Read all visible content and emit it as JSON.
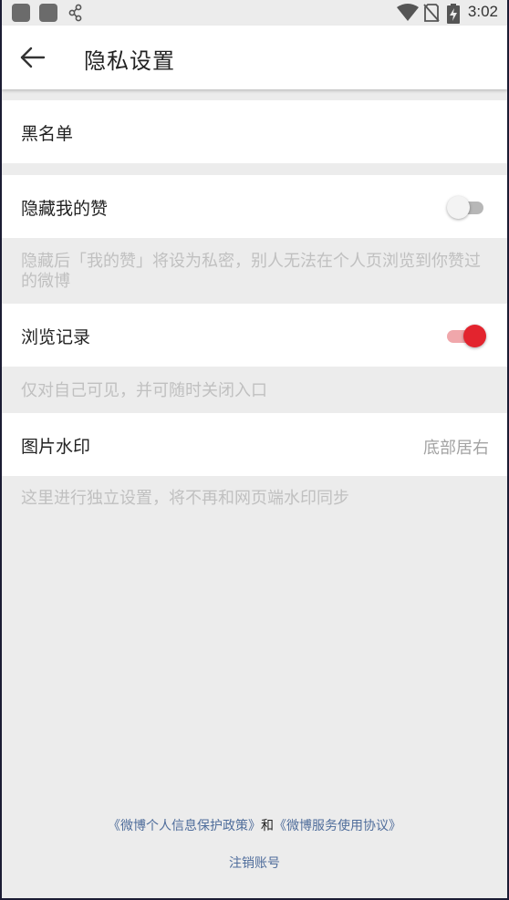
{
  "status_bar": {
    "time": "3:02",
    "icons": [
      "app-notification-icon",
      "app-notification-icon",
      "share-icon",
      "wifi-icon",
      "no-sim-icon",
      "battery-charging-icon"
    ]
  },
  "header": {
    "title": "隐私设置",
    "back_icon": "arrow-left-icon"
  },
  "settings": {
    "blacklist": {
      "label": "黑名单"
    },
    "hide_likes": {
      "label": "隐藏我的赞",
      "enabled": false,
      "hint": "隐藏后「我的赞」将设为私密，别人无法在个人页浏览到你赞过的微博"
    },
    "browsing_history": {
      "label": "浏览记录",
      "enabled": true,
      "hint": "仅对自己可见，并可随时关闭入口"
    },
    "watermark": {
      "label": "图片水印",
      "value": "底部居右",
      "hint": "这里进行独立设置，将不再和网页端水印同步"
    }
  },
  "footer": {
    "privacy_policy": "《微博个人信息保护政策》",
    "conjunction": "和",
    "service_agreement": "《微博服务使用协议》",
    "deregister": "注销账号"
  },
  "colors": {
    "accent": "#e3242e",
    "link": "#4f6d9b",
    "background": "#ececec",
    "hint_text": "#c0c0c0"
  }
}
